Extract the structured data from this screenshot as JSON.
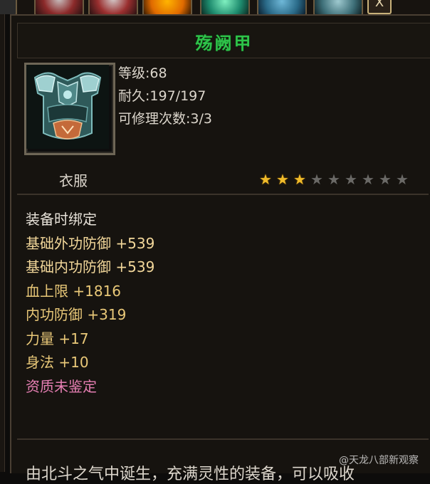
{
  "close_symbol": "X",
  "topbar": {
    "slots": [
      {
        "icon": "bow-item-icon"
      },
      {
        "icon": "red-robe-item-icon"
      },
      {
        "icon": "red-robe-item-icon"
      },
      {
        "icon": "golden-ring-item-icon"
      },
      {
        "icon": "jade-orb-item-icon"
      },
      {
        "icon": "blue-armor-item-icon"
      },
      {
        "icon": "teal-boots-item-icon"
      }
    ]
  },
  "item": {
    "name": "殇阙甲",
    "name_color": "#2ec34a",
    "icon": "armor-chestplate-icon",
    "level": "等级:68",
    "durability": "耐久:197/197",
    "repairs": "可修理次数:3/3",
    "type": "衣服",
    "stars_total": 9,
    "stars_filled": 3,
    "attributes": [
      {
        "text": "装备时绑定",
        "color": "#e6e1d8"
      },
      {
        "text": "基础外功防御  +539",
        "color": "#f2d79a"
      },
      {
        "text": "基础内功防御  +539",
        "color": "#f2d79a"
      },
      {
        "text": "血上限  +1816",
        "color": "#e9c878"
      },
      {
        "text": "内功防御  +319",
        "color": "#e9c878"
      },
      {
        "text": "力量  +17",
        "color": "#e9c878"
      },
      {
        "text": "身法  +10",
        "color": "#e9c878"
      },
      {
        "text": "资质未鉴定",
        "color": "#e67fb3"
      }
    ],
    "description": "由北斗之气中诞生，充满灵性的装备，可以吸收"
  },
  "watermark": "@天龙八部新观察"
}
